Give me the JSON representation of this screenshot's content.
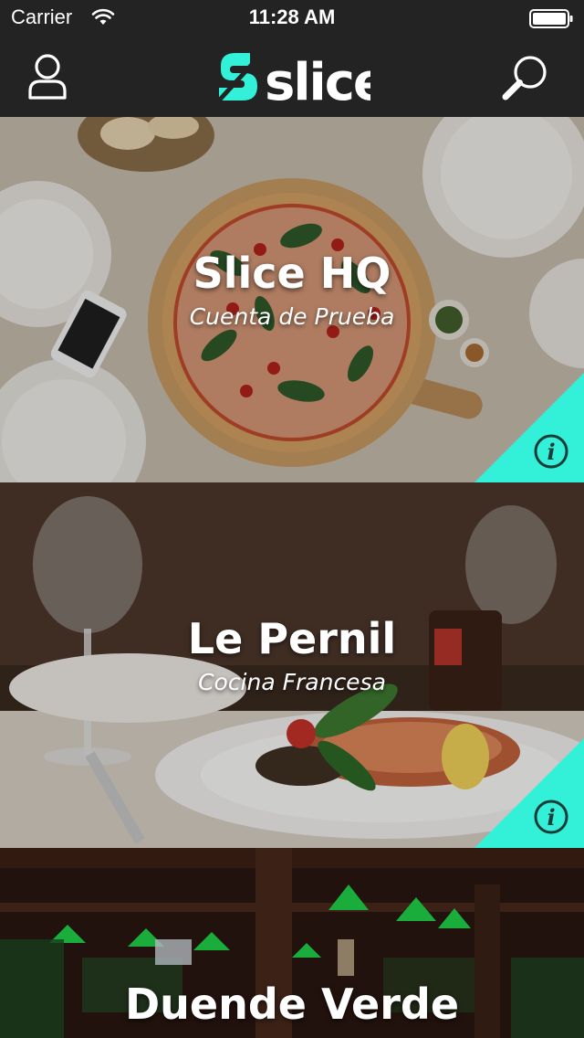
{
  "status_bar": {
    "carrier": "Carrier",
    "time": "11:28 AM"
  },
  "nav": {
    "logo_text": "slice",
    "user_icon": "user-icon",
    "search_icon": "search-icon"
  },
  "colors": {
    "accent": "#33f0d8",
    "bar_bg": "#232323"
  },
  "restaurants": [
    {
      "name": "Slice HQ",
      "subtitle": "Cuenta de Prueba",
      "info_icon": "info-icon"
    },
    {
      "name": "Le Pernil",
      "subtitle": "Cocina Francesa",
      "info_icon": "info-icon"
    },
    {
      "name": "Duende Verde",
      "subtitle": ""
    }
  ]
}
